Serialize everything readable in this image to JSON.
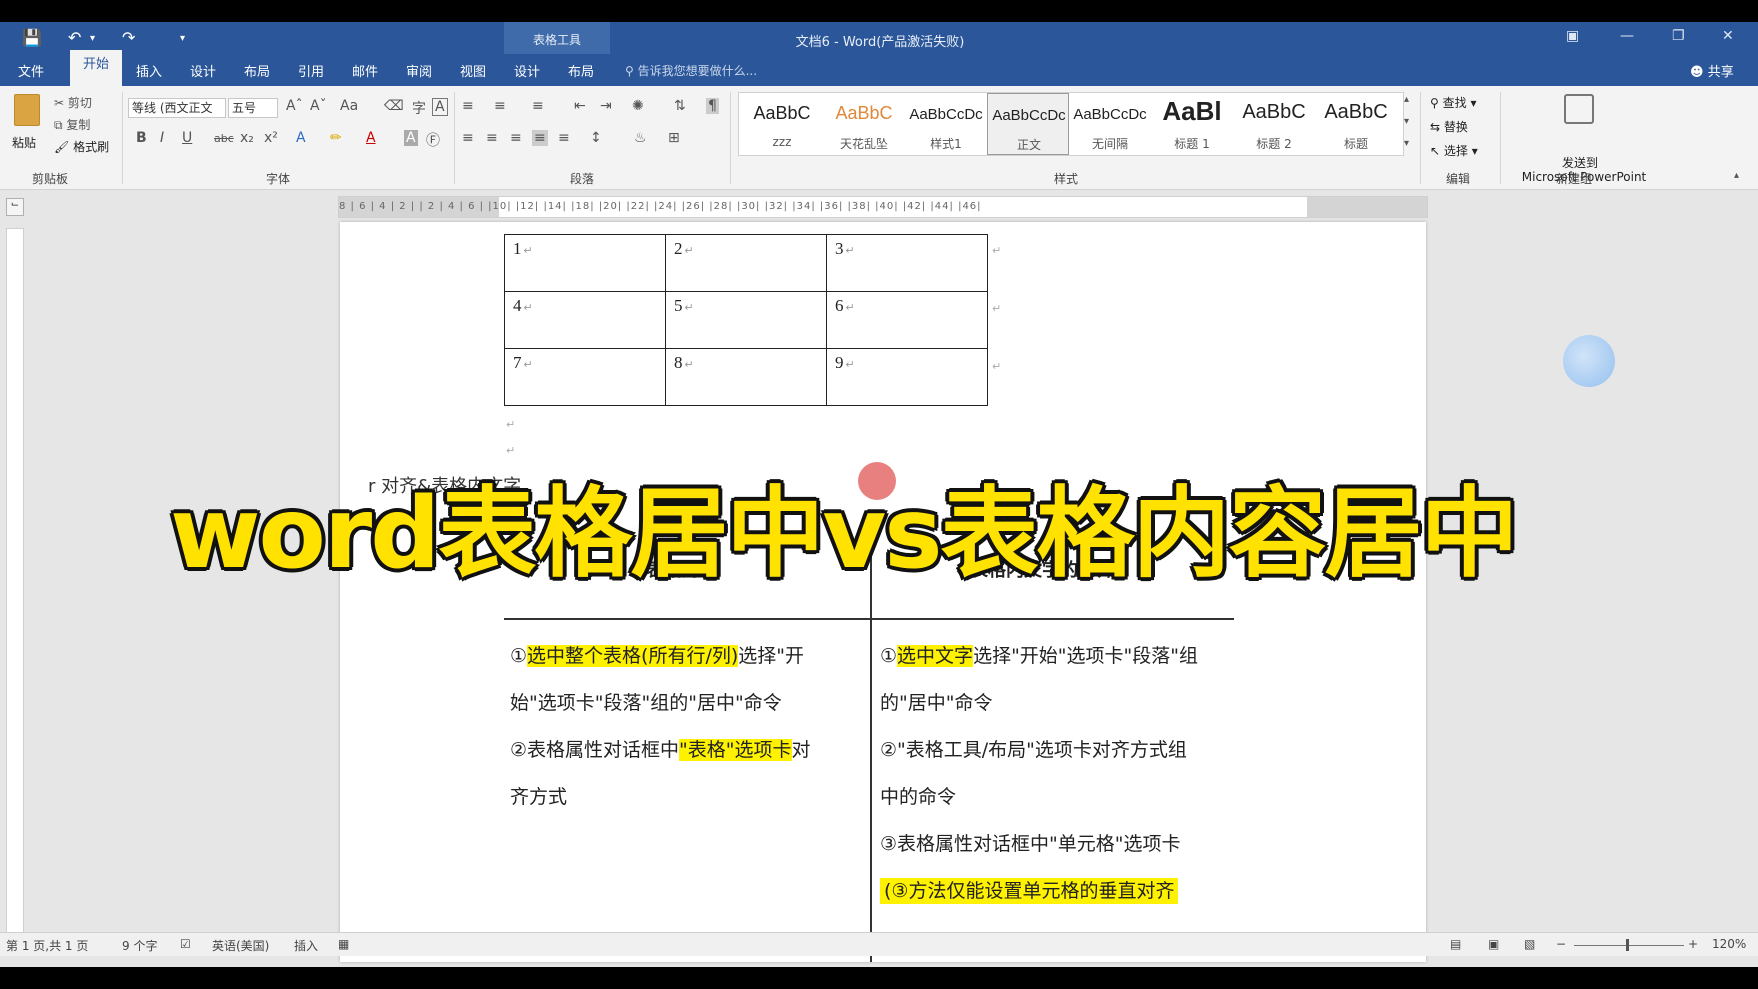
{
  "titlebar": {
    "context_tab_group": "表格工具",
    "document_title": "文档6 - Word(产品激活失败)"
  },
  "tabs": [
    {
      "label": "文件"
    },
    {
      "label": "开始"
    },
    {
      "label": "插入"
    },
    {
      "label": "设计"
    },
    {
      "label": "布局"
    },
    {
      "label": "引用"
    },
    {
      "label": "邮件"
    },
    {
      "label": "审阅"
    },
    {
      "label": "视图"
    },
    {
      "label": "设计"
    },
    {
      "label": "布局"
    }
  ],
  "tell_me": "告诉我您想要做什么...",
  "share": "共享",
  "ribbon": {
    "clipboard": {
      "paste": "粘贴",
      "cut": "剪切",
      "copy": "复制",
      "format_painter": "格式刷",
      "label": "剪贴板"
    },
    "font": {
      "font_name": "等线 (西文正文",
      "font_size": "五号",
      "label": "字体"
    },
    "paragraph": {
      "label": "段落"
    },
    "styles": {
      "label": "样式",
      "items": [
        {
          "sample": "AaBbC",
          "name": "zzz"
        },
        {
          "sample": "AaBbC",
          "name": "天花乱坠"
        },
        {
          "sample": "AaBbCcDc",
          "name": "样式1"
        },
        {
          "sample": "AaBbCcDc",
          "name": "正文"
        },
        {
          "sample": "AaBbCcDc",
          "name": "无间隔"
        },
        {
          "sample": "AaBl",
          "name": "标题 1"
        },
        {
          "sample": "AaBbC",
          "name": "标题 2"
        },
        {
          "sample": "AaBbC",
          "name": "标题"
        }
      ]
    },
    "editing": {
      "find": "查找",
      "replace": "替换",
      "select": "选择",
      "label": "编辑"
    },
    "newgroup": {
      "send_to": "发送到",
      "target": "Microsoft PowerPoint",
      "label": "新建组"
    }
  },
  "ruler": "8 | 6 | 4 | 2 |  | 2 | 4 | 6 |  |10| |12| |14|  |18| |20| |22| |24| |26| |28| |30| |32| |34| |36| |38| |40| |42| |44| |46|",
  "grid_table": [
    [
      "1",
      "2",
      "3"
    ],
    [
      "4",
      "5",
      "6"
    ],
    [
      "7",
      "8",
      "9"
    ]
  ],
  "caption": "r   对齐&表格内文字",
  "comparison": {
    "left_header": "表格对齐",
    "right_header": "表格内文字的对齐",
    "left_lines": [
      {
        "pre": "①",
        "hl": "选中整个表格(所有行/列)",
        "post": "选择\"开"
      },
      {
        "pre": "   始\"选项卡\"段落\"组的\"居中\"命令",
        "hl": "",
        "post": ""
      },
      {
        "pre": "②表格属性对话框中",
        "hl": "\"表格\"选项卡",
        "post": "对"
      },
      {
        "pre": "齐方式",
        "hl": "",
        "post": ""
      }
    ],
    "right_lines": [
      {
        "pre": "①",
        "hl": "选中文字",
        "post": "选择\"开始\"选项卡\"段落\"组"
      },
      {
        "pre": "的\"居中\"命令",
        "hl": "",
        "post": ""
      },
      {
        "pre": "②\"表格工具/布局\"选项卡对齐方式组",
        "hl": "",
        "post": ""
      },
      {
        "pre": "中的命令",
        "hl": "",
        "post": ""
      },
      {
        "pre": "③表格属性对话框中\"单元格\"选项卡",
        "hl": "",
        "post": ""
      },
      {
        "pre": "",
        "hl": "(③方法仅能设置单元格的垂直对齐",
        "post": ""
      }
    ]
  },
  "overlay_title": "word表格居中vs表格内容居中",
  "statusbar": {
    "page": "第 1 页,共 1 页",
    "words": "9 个字",
    "language": "英语(美国)",
    "mode": "插入",
    "zoom": "120%"
  },
  "colors": {
    "word_blue": "#2b579a",
    "highlight": "#fff200",
    "overlay_text": "#ffe200"
  }
}
